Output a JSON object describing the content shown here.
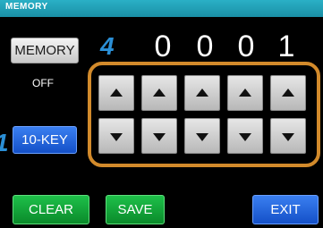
{
  "header": {
    "title": "MEMORY"
  },
  "memory_button": {
    "label": "MEMORY"
  },
  "memory_status": "OFF",
  "tenkey_button": {
    "label": "10-KEY"
  },
  "callouts": {
    "left_marker": "1",
    "step_marker": "4"
  },
  "digits": [
    "0",
    "0",
    "0",
    "1"
  ],
  "steppers": {
    "up_icon": "triangle-up-icon",
    "down_icon": "triangle-down-icon",
    "columns": 5
  },
  "footer": {
    "clear_label": "CLEAR",
    "save_label": "SAVE",
    "exit_label": "EXIT"
  },
  "colors": {
    "title_bar": "#1a8fa5",
    "highlight_outline": "#d28a2b",
    "callout_blue": "#2b8fd6",
    "green_button": "#0a8a2a",
    "blue_button": "#1450c8"
  }
}
